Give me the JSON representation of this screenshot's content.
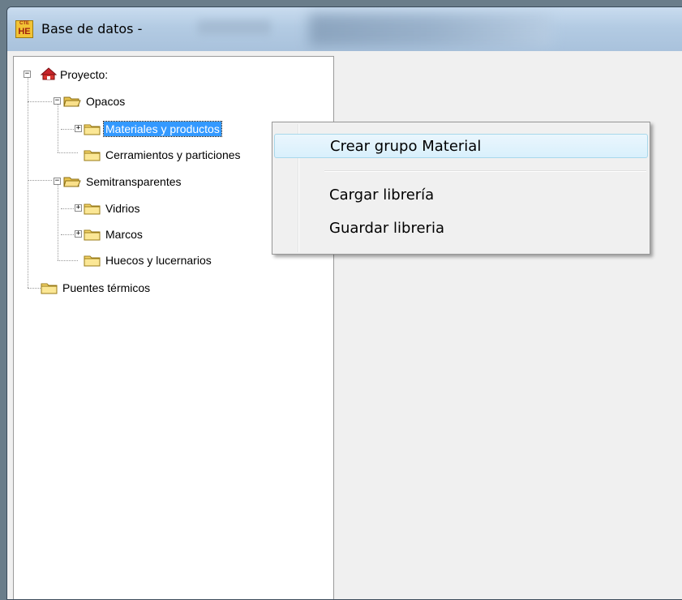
{
  "window": {
    "title": "Base de datos -",
    "icon_top": "CTE",
    "icon_bottom": "HE"
  },
  "tree": {
    "root": {
      "label": "Proyecto:",
      "icon": "house-icon",
      "expander": "−"
    },
    "opacos": {
      "label": "Opacos",
      "expander": "−"
    },
    "materiales": {
      "label": "Materiales y productos",
      "expander": "+",
      "selected": true
    },
    "cerramientos": {
      "label": "Cerramientos y particiones"
    },
    "semitransparentes": {
      "label": "Semitransparentes",
      "expander": "−"
    },
    "vidrios": {
      "label": "Vidrios",
      "expander": "+"
    },
    "marcos": {
      "label": "Marcos",
      "expander": "+"
    },
    "huecos": {
      "label": "Huecos y lucernarios"
    },
    "puentes": {
      "label": "Puentes térmicos"
    }
  },
  "context_menu": {
    "items": [
      {
        "label": "Crear grupo Material",
        "highlighted": true
      },
      {
        "label": "Cargar librería"
      },
      {
        "label": "Guardar libreria"
      }
    ]
  },
  "colors": {
    "selection": "#3399ff",
    "folder": "#f5d66b",
    "menu_highlight": "#d9f0fc"
  }
}
